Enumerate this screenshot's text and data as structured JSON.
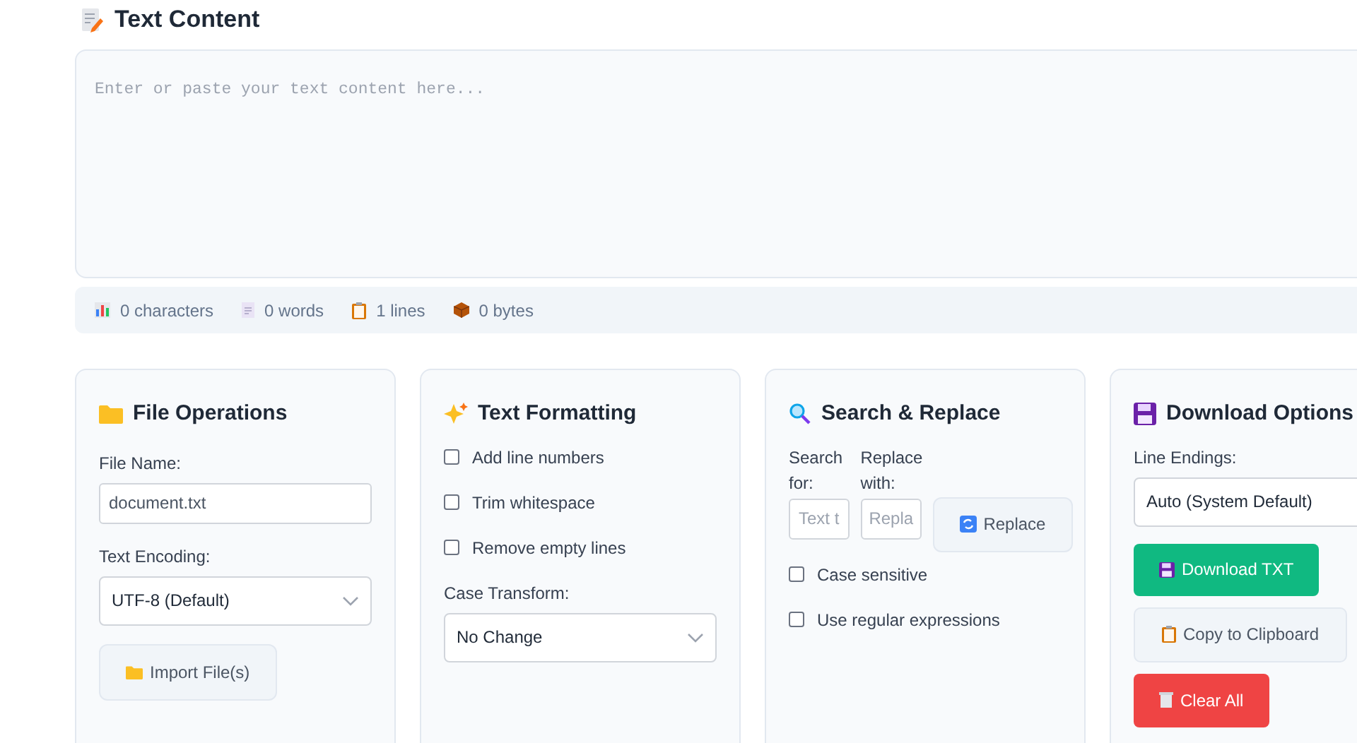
{
  "heading": "Text Content",
  "editor": {
    "placeholder": "Enter or paste your text content here..."
  },
  "stats": [
    {
      "kind": "chart",
      "text": "0 characters"
    },
    {
      "kind": "page",
      "text": "0 words"
    },
    {
      "kind": "clipboard",
      "text": "1 lines"
    },
    {
      "kind": "box",
      "text": "0 bytes"
    }
  ],
  "file_operations": {
    "title": "File Operations",
    "file_name_label": "File Name:",
    "file_name": "document.txt",
    "encoding_label": "Text Encoding:",
    "encoding": "UTF-8 (Default)",
    "import_button": "Import File(s)"
  },
  "text_formatting": {
    "title": "Text Formatting",
    "options": [
      {
        "label": "Add line numbers",
        "checked": false
      },
      {
        "label": "Trim whitespace",
        "checked": false
      },
      {
        "label": "Remove empty lines",
        "checked": false
      }
    ],
    "case_label": "Case Transform:",
    "case_value": "No Change"
  },
  "search_replace": {
    "title": "Search & Replace",
    "search_label": "Search for:",
    "search_placeholder": "Text t",
    "replace_label": "Replace with:",
    "replace_placeholder": "Repla",
    "replace_button": "Replace",
    "options": [
      {
        "label": "Case sensitive",
        "checked": false
      },
      {
        "label": "Use regular expressions",
        "checked": false
      }
    ]
  },
  "download_options": {
    "title": "Download Options",
    "line_endings_label": "Line Endings:",
    "line_endings": "Auto (System Default)",
    "buttons": [
      {
        "kind": "primary",
        "label": "Download TXT"
      },
      {
        "kind": "secondary",
        "label": "Copy to Clipboard"
      },
      {
        "kind": "danger",
        "label": "Clear All"
      }
    ]
  }
}
